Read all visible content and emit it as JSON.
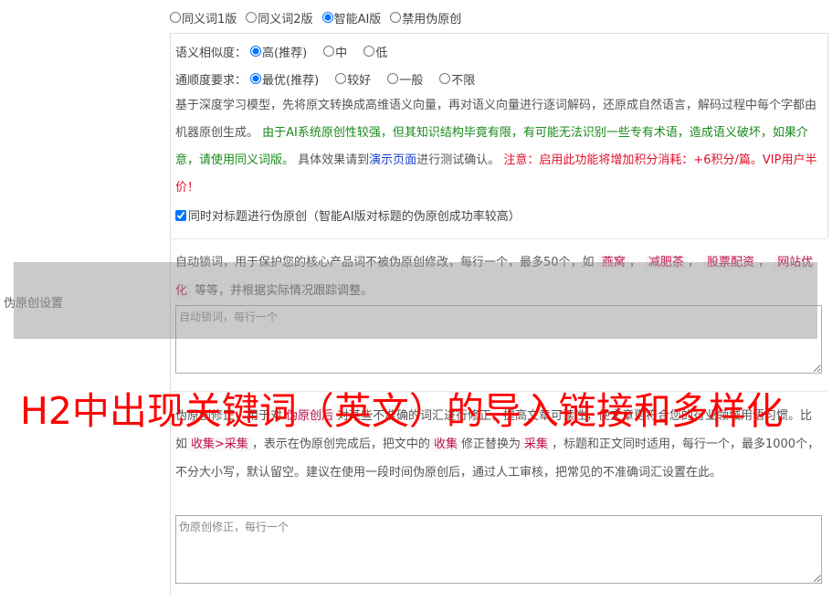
{
  "section_label": "伪原创设置",
  "modes": [
    {
      "label": "同义词1版",
      "checked": false
    },
    {
      "label": "同义词2版",
      "checked": false
    },
    {
      "label": "智能AI版",
      "checked": true
    },
    {
      "label": "禁用伪原创",
      "checked": false
    }
  ],
  "similarity": {
    "label": "语义相似度：",
    "options": [
      {
        "label": "高(推荐)",
        "checked": true
      },
      {
        "label": "中",
        "checked": false
      },
      {
        "label": "低",
        "checked": false
      }
    ]
  },
  "fluency": {
    "label": "通顺度要求：",
    "options": [
      {
        "label": "最优(推荐)",
        "checked": true
      },
      {
        "label": "较好",
        "checked": false
      },
      {
        "label": "一般",
        "checked": false
      },
      {
        "label": "不限",
        "checked": false
      }
    ]
  },
  "description": {
    "part1": "基于深度学习模型，先将原文转换成高维语义向量，再对语义向量进行逐词解码，还原成自然语言，解码过程中每个字都由机器原创生成。",
    "part2_green": "由于AI系统原创性较强，但其知识结构毕竟有限，有可能无法识别一些专有术语，造成语义破坏，如果介意，请使用同义词版。",
    "part3": "具体效果请到",
    "link": "演示页面",
    "part4": "进行测试确认。",
    "part5_red": "注意：启用此功能将增加积分消耗：+6积分/篇。VIP用户半价！"
  },
  "title_checkbox": {
    "label": "同时对标题进行伪原创（智能AI版对标题的伪原创成功率较高）",
    "checked": true
  },
  "lock_words": {
    "text1": "自动锁词，用于保护您的核心产品词不被伪原创修改，每行一个，最多50个，如",
    "examples": [
      "燕窝",
      "减肥茶",
      "股票配资",
      "网站优化"
    ],
    "sep": "，",
    "text2": "等等，并根据实际情况跟踪调整。",
    "placeholder": "自动锁词，每行一个"
  },
  "correction": {
    "text1": "伪原创修正，用于对",
    "tag1": "伪原创后",
    "text2": "对某些不准确的词汇进行修正，提高文章可读性，使文章更符合您的行业领域用语习惯。比如",
    "tag2": "收集>采集",
    "text3": "，表示在伪原创完成后，把文中的",
    "tag3": "收集",
    "text4": "修正替换为",
    "tag4": "采集",
    "text5": "，标题和正文同时适用，每行一个，最多1000个，不分大小写，默认留空。建议在使用一段时间伪原创后，通过人工审核，把常见的不准确词汇设置在此。",
    "placeholder": "伪原创修正，每行一个"
  },
  "overlay_title": "H2中出现关键词（英文）的导入链接和多样化"
}
